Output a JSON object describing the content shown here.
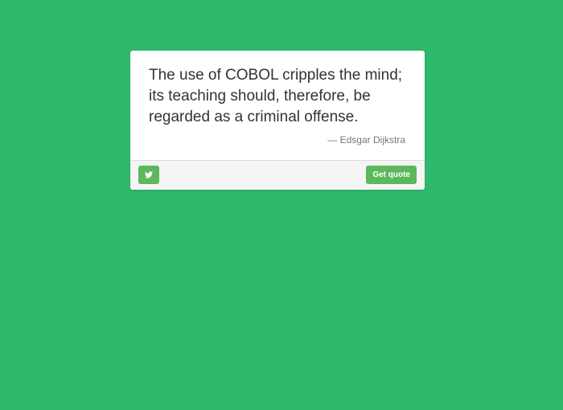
{
  "background_color": "#2eb86b",
  "accent_color": "#5cb85c",
  "quote": {
    "text": "The use of COBOL cripples the mind; its teaching should, therefore, be regarded as a criminal offense.",
    "author": "— Edsgar Dijkstra"
  },
  "footer": {
    "tweet_icon": "twitter-icon",
    "get_quote_label": "Get quote"
  }
}
